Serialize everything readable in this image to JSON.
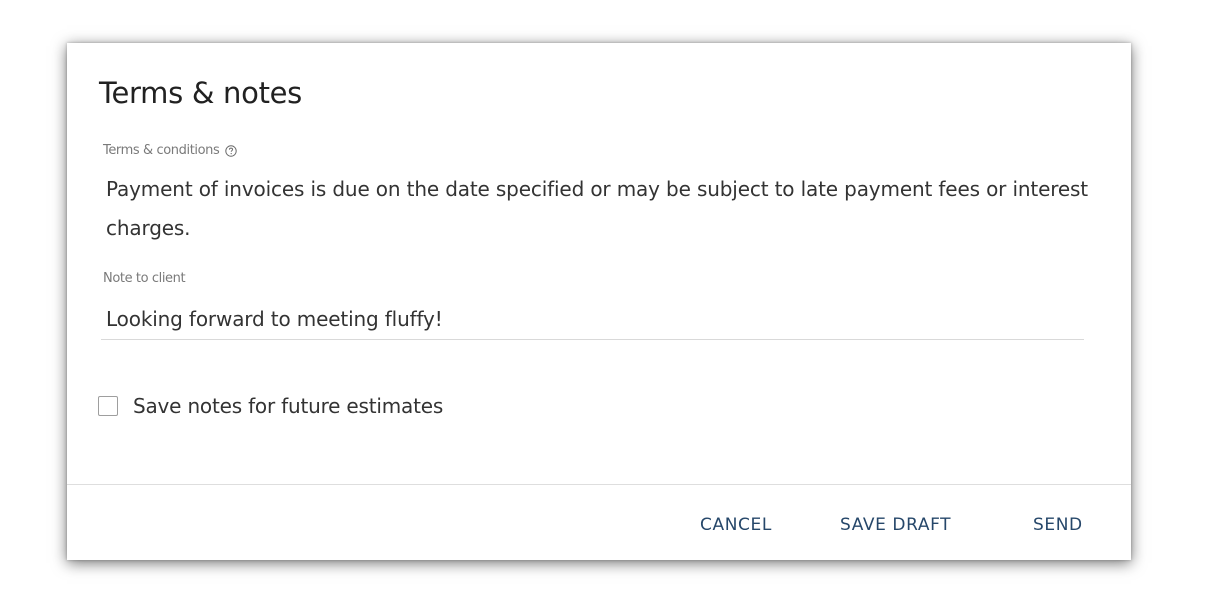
{
  "dialog": {
    "title": "Terms & notes",
    "terms_label": "Terms & conditions",
    "terms_text": "Payment of invoices is due on the date specified or may be subject to late payment fees or interest charges.",
    "note_label": "Note to client",
    "note_value": "Looking forward to meeting fluffy!",
    "save_notes_label": "Save notes for future estimates",
    "save_notes_checked": false
  },
  "actions": {
    "cancel": "CANCEL",
    "save_draft": "SAVE DRAFT",
    "send": "SEND"
  },
  "colors": {
    "accent": "#26476a",
    "text": "#333333",
    "label": "#7a7a7a"
  },
  "icons": {
    "help": "question-circle-icon"
  }
}
